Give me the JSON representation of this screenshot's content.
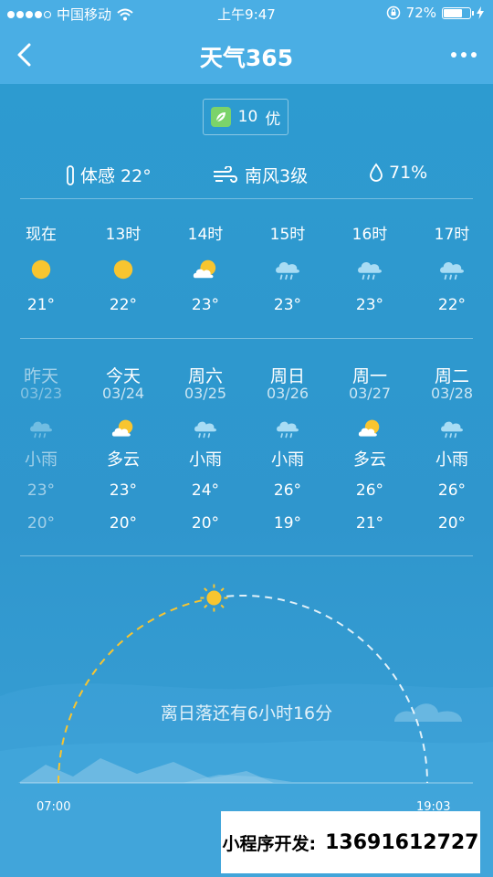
{
  "status": {
    "carrier": "中国移动",
    "time": "上午9:47",
    "battery": "72%",
    "battery_level": 0.72,
    "signal_bars": 4
  },
  "nav": {
    "title": "天气365"
  },
  "aqi": {
    "value": "10",
    "level": "优"
  },
  "metrics": {
    "feels_like": "体感 22°",
    "wind": "南风3级",
    "humidity": "71%"
  },
  "hourly": [
    {
      "label": "现在",
      "icon": "sun",
      "temp": "21°"
    },
    {
      "label": "13时",
      "icon": "sun",
      "temp": "22°"
    },
    {
      "label": "14时",
      "icon": "partly-cloudy",
      "temp": "23°"
    },
    {
      "label": "15时",
      "icon": "rain",
      "temp": "23°"
    },
    {
      "label": "16时",
      "icon": "rain",
      "temp": "23°"
    },
    {
      "label": "17时",
      "icon": "rain",
      "temp": "22°"
    }
  ],
  "daily": [
    {
      "name": "昨天",
      "date": "03/23",
      "icon": "rain",
      "cond": "小雨",
      "high": "23°",
      "low": "20°",
      "past": true
    },
    {
      "name": "今天",
      "date": "03/24",
      "icon": "partly-cloudy",
      "cond": "多云",
      "high": "23°",
      "low": "20°",
      "past": false
    },
    {
      "name": "周六",
      "date": "03/25",
      "icon": "rain",
      "cond": "小雨",
      "high": "24°",
      "low": "20°",
      "past": false
    },
    {
      "name": "周日",
      "date": "03/26",
      "icon": "rain",
      "cond": "小雨",
      "high": "26°",
      "low": "19°",
      "past": false
    },
    {
      "name": "周一",
      "date": "03/27",
      "icon": "partly-cloudy",
      "cond": "多云",
      "high": "26°",
      "low": "21°",
      "past": false
    },
    {
      "name": "周二",
      "date": "03/28",
      "icon": "rain",
      "cond": "小雨",
      "high": "26°",
      "low": "20°",
      "past": false
    }
  ],
  "sun": {
    "message": "离日落还有6小时16分",
    "sunrise": "07:00",
    "sunset": "19:03",
    "progress": 0.45
  },
  "promo": {
    "label": "小程序开发:",
    "phone": "13691612727"
  },
  "colors": {
    "sun": "#f8c530",
    "rain_cloud": "#a8dcf4",
    "leaf": "#7bd36a"
  }
}
